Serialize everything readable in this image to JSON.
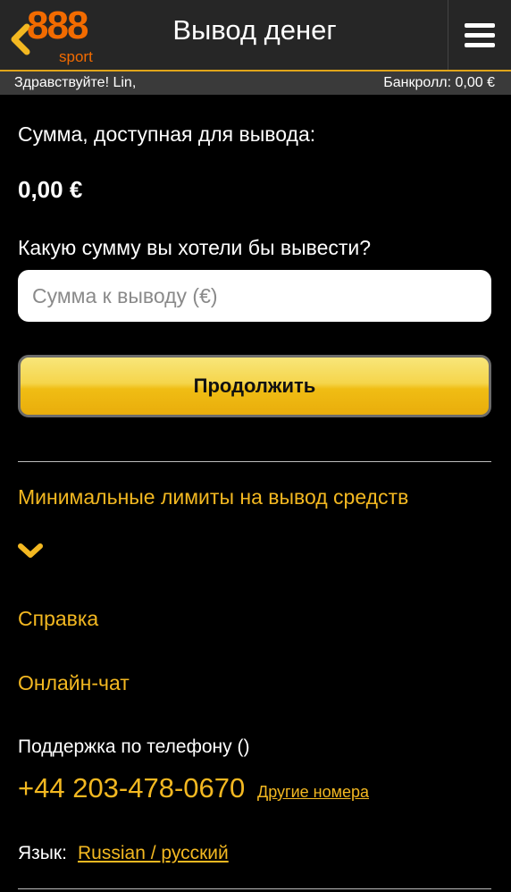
{
  "header": {
    "logo_number": "888",
    "logo_sport": "sport",
    "title": "Вывод денег"
  },
  "subbar": {
    "greeting": "Здравствуйте! Lin,",
    "bankroll": "Банкролл: 0,00 €"
  },
  "withdraw": {
    "available_label": "Сумма, доступная для вывода:",
    "available_amount": "0,00 €",
    "question": "Какую сумму вы хотели бы вывести?",
    "amount_placeholder": "Сумма к выводу (€)",
    "continue_label": "Продолжить"
  },
  "links": {
    "min_limits": "Минимальные лимиты на вывод средств",
    "help": "Справка",
    "live_chat": "Онлайн-чат"
  },
  "support": {
    "phone_label": "Поддержка по телефону ()",
    "phone_number": "+44 203-478-0670",
    "other_numbers": "Другие номера"
  },
  "language": {
    "label": "Язык:",
    "value": "Russian / русский"
  },
  "colors": {
    "accent": "#f3b821",
    "brand": "#f26b00",
    "background": "#000000"
  }
}
